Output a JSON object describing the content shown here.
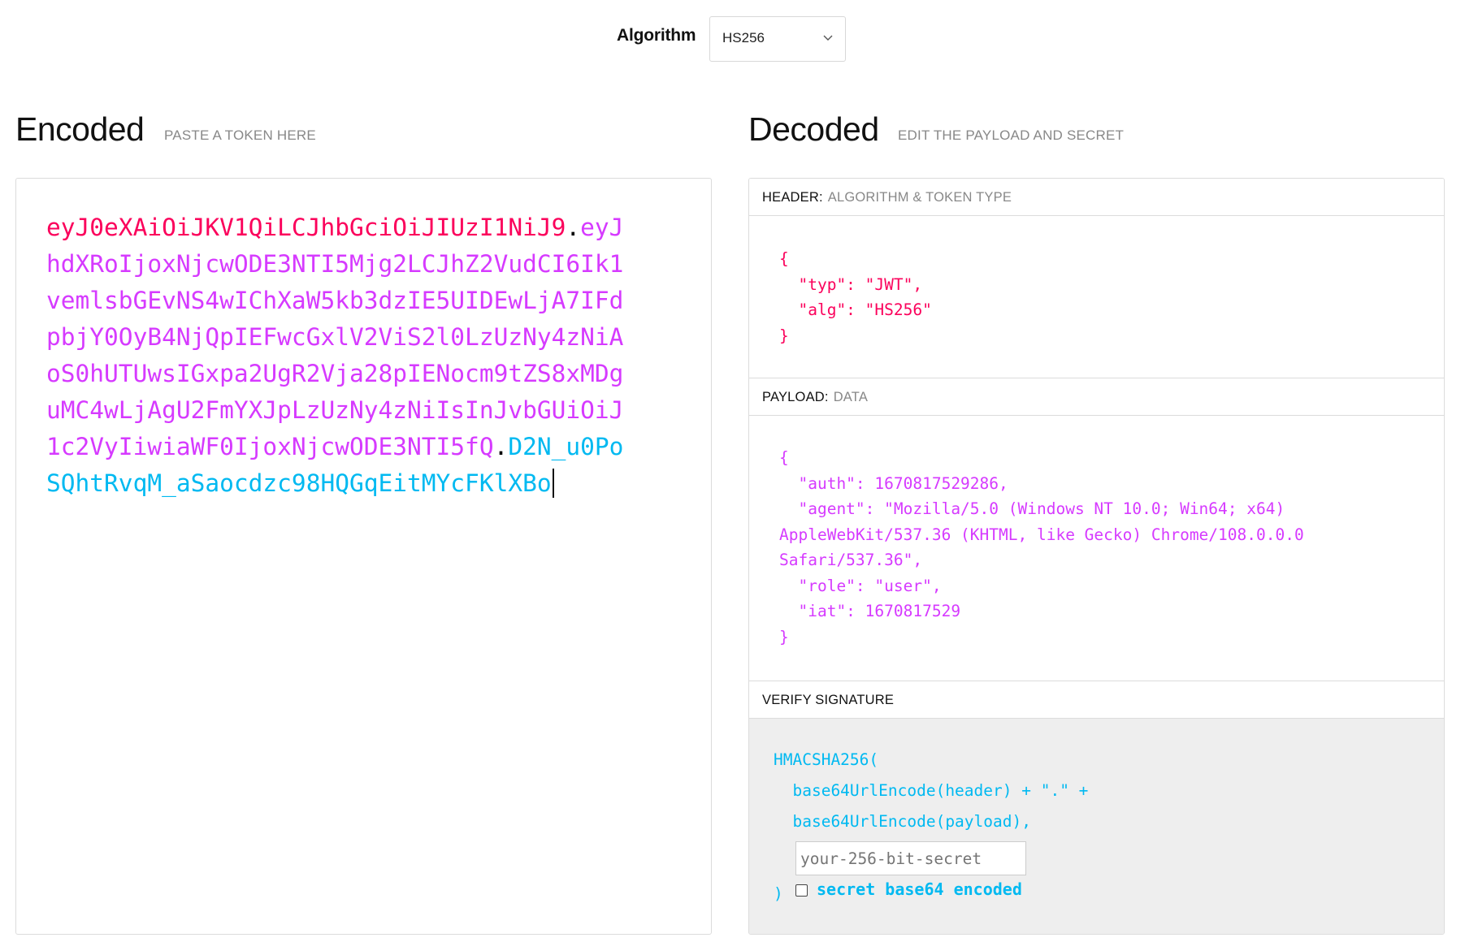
{
  "algorithm": {
    "label": "Algorithm",
    "selected": "HS256"
  },
  "encoded": {
    "title": "Encoded",
    "subtitle": "PASTE A TOKEN HERE",
    "token_header": "eyJ0eXAiOiJKV1QiLCJhbGciOiJIUzI1NiJ9",
    "dot1": ".",
    "token_payload": "eyJhdXRoIjoxNjcwODE3NTI5Mjg2LCJhZ2VudCI6Ik1vemlsbGEvNS4wIChXaW5kb3dzIE5UIDEwLjA7IFdpbjY0OyB4NjQpIEFwcGxlV2ViS2l0LzUzNy4zNiAoS0hUTUwsIGxpa2UgR2Vja28pIENocm9tZS8xMDguMC4wLjAgU2FmYXJpLzUzNy4zNiIsInJvbGUiOiJ1c2VyIiwiaWF0IjoxNjcwODE3NTI5fQ",
    "dot2": ".",
    "token_signature": "D2N_u0PoSQhtRvqM_aSaocdzc98HQGqEitMYcFKlXBo"
  },
  "decoded": {
    "title": "Decoded",
    "subtitle": "EDIT THE PAYLOAD AND SECRET",
    "header_section": {
      "label": "HEADER:",
      "sub": "ALGORITHM & TOKEN TYPE",
      "json_lines": [
        "{",
        "  \"typ\": \"JWT\",",
        "  \"alg\": \"HS256\"",
        "}"
      ]
    },
    "payload_section": {
      "label": "PAYLOAD:",
      "sub": "DATA",
      "json_lines": [
        "{",
        "  \"auth\": 1670817529286,",
        "  \"agent\": \"Mozilla/5.0 (Windows NT 10.0; Win64; x64)",
        "AppleWebKit/537.36 (KHTML, like Gecko) Chrome/108.0.0.0",
        "Safari/537.36\",",
        "  \"role\": \"user\",",
        "  \"iat\": 1670817529",
        "}"
      ]
    },
    "verify_section": {
      "label": "VERIFY SIGNATURE",
      "line1": "HMACSHA256(",
      "line2": "  base64UrlEncode(header) + \".\" +",
      "line3": "  base64UrlEncode(payload),",
      "secret_placeholder": "your-256-bit-secret",
      "close_paren": ")",
      "checkbox_label": "secret base64 encoded",
      "checkbox_checked": false
    }
  },
  "colors": {
    "header": "#fb015b",
    "payload": "#d63aff",
    "signature": "#00b9f1"
  },
  "icons": {
    "dropdown": "chevron-down-icon"
  }
}
